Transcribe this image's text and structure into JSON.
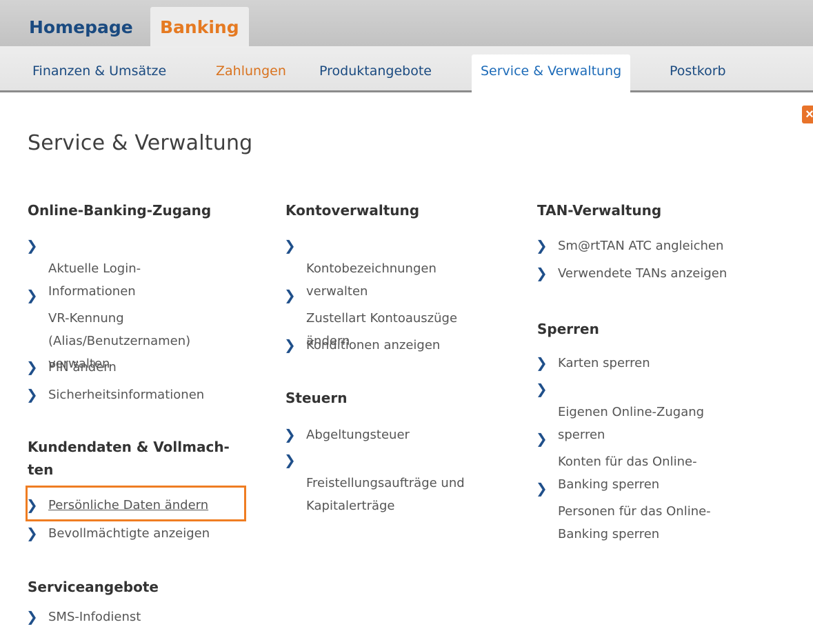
{
  "top_nav": {
    "tabs": [
      {
        "label": "Homepage"
      },
      {
        "label": "Banking"
      }
    ]
  },
  "sub_nav": {
    "tabs": [
      {
        "label": "Finanzen & Umsätze"
      },
      {
        "label": "Zahlungen"
      },
      {
        "label": "Produktangebote"
      },
      {
        "label": "Service & Verwaltung"
      },
      {
        "label": "Postkorb"
      }
    ]
  },
  "close_icon": "×",
  "page_title": "Service & Verwaltung",
  "sections": {
    "online_banking": {
      "title": "Online-Banking-Zugang",
      "items": [
        {
          "label": "Aktuelle Login-\nInformationen"
        },
        {
          "label": "VR-Kennung\n(Alias/Benutzernamen)\nverwalten"
        },
        {
          "label": "PIN ändern"
        },
        {
          "label": "Sicherheitsinformationen"
        }
      ]
    },
    "kundendaten": {
      "title": "Kundendaten & Vollmach-\nten",
      "items": [
        {
          "label": "Persönliche Daten ändern"
        },
        {
          "label": "Bevollmächtigte anzeigen"
        }
      ]
    },
    "serviceangebote": {
      "title": "Serviceangebote",
      "items": [
        {
          "label": "SMS-Infodienst"
        }
      ]
    },
    "kontoverwaltung": {
      "title": "Kontoverwaltung",
      "items": [
        {
          "label": "Kontobezeichnungen\nverwalten"
        },
        {
          "label": "Zustellart Kontoauszüge\nändern"
        },
        {
          "label": "Konditionen anzeigen"
        }
      ]
    },
    "steuern": {
      "title": "Steuern",
      "items": [
        {
          "label": "Abgeltungsteuer"
        },
        {
          "label": "Freistellungsaufträge und\nKapitalerträge"
        }
      ]
    },
    "tan": {
      "title": "TAN-Verwaltung",
      "items": [
        {
          "label": "Sm@rtTAN ATC angleichen"
        },
        {
          "label": "Verwendete TANs anzeigen"
        }
      ]
    },
    "sperren": {
      "title": "Sperren",
      "items": [
        {
          "label": "Karten sperren"
        },
        {
          "label": "Eigenen Online-Zugang\nsperren"
        },
        {
          "label": "Konten für das Online-\nBanking sperren"
        },
        {
          "label": "Personen für das Online-\nBanking sperren"
        }
      ]
    }
  }
}
